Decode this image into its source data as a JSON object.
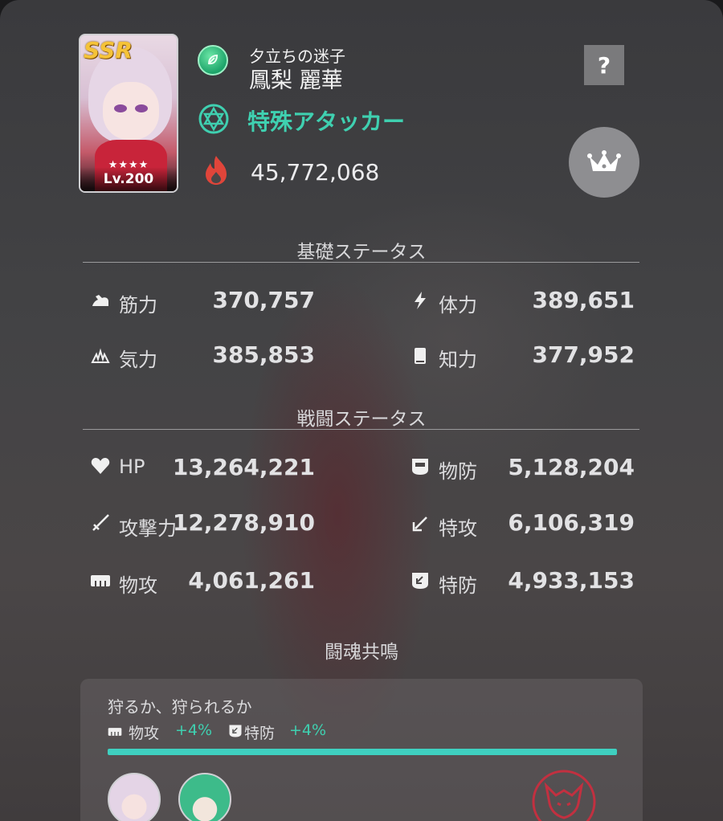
{
  "header": {
    "rarity": "SSR",
    "stars": "★★★★",
    "level": "Lv.200",
    "subtitle": "夕立ちの迷子",
    "character_name": "鳳梨 麗華",
    "role": "特殊アタッカー",
    "power": "45,772,068",
    "help_label": "?",
    "element_icon": "leaf-element-icon",
    "role_icon": "hexagram-icon",
    "power_icon": "fire-icon",
    "crown_icon": "crown-icon"
  },
  "basic_status": {
    "title": "基礎ステータス",
    "stats": [
      {
        "icon": "muscle-icon",
        "label": "筋力",
        "value": "370,757"
      },
      {
        "icon": "lightning-icon",
        "label": "体力",
        "value": "389,651"
      },
      {
        "icon": "spirit-icon",
        "label": "気力",
        "value": "385,853"
      },
      {
        "icon": "book-icon",
        "label": "知力",
        "value": "377,952"
      }
    ]
  },
  "battle_status": {
    "title": "戦闘ステータス",
    "stats": [
      {
        "icon": "heart-icon",
        "label": "HP",
        "value": "13,264,221"
      },
      {
        "icon": "physical-defense-icon",
        "label": "物防",
        "value": "5,128,204"
      },
      {
        "icon": "sword-icon",
        "label": "攻撃力",
        "value": "12,278,910"
      },
      {
        "icon": "special-attack-icon",
        "label": "特攻",
        "value": "6,106,319"
      },
      {
        "icon": "fist-icon",
        "label": "物攻",
        "value": "4,061,261"
      },
      {
        "icon": "special-defense-icon",
        "label": "特防",
        "value": "4,933,153"
      }
    ]
  },
  "resonance": {
    "title": "闘魂共鳴",
    "card_title": "狩るか、狩られるか",
    "bonuses": [
      {
        "icon": "fist-icon",
        "label": "物攻",
        "value": "+4%"
      },
      {
        "icon": "special-defense-icon",
        "label": "特防",
        "value": "+4%"
      }
    ],
    "progress": 1.0
  },
  "colors": {
    "accent": "#3fd0b0",
    "fire": "#e0453a",
    "emblem": "#c23040"
  }
}
